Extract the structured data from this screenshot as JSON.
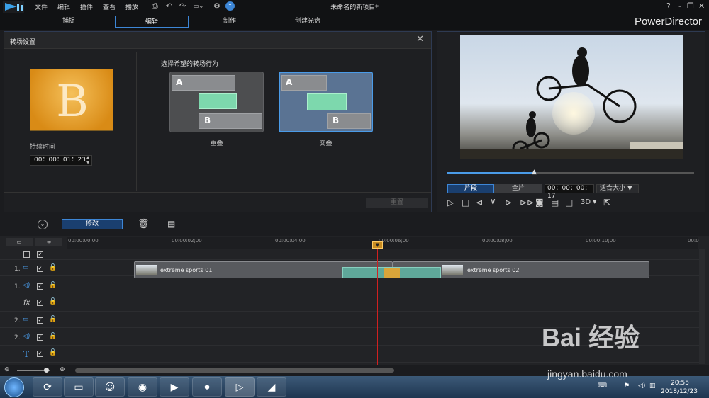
{
  "menu": [
    "文件",
    "编辑",
    "插件",
    "查看",
    "播放"
  ],
  "window_title": "未命名的新项目*",
  "modes": [
    "捕捉",
    "编辑",
    "制作",
    "创建光盘"
  ],
  "brand": "PowerDirector",
  "transition": {
    "panel_title": "转场设置",
    "thumb_letter": "B",
    "duration_label": "持续时间",
    "duration_value": "00：00：01：23",
    "choose_label": "选择希望的转场行为",
    "option1": {
      "label": "重叠",
      "a": "A",
      "b": "B"
    },
    "option2": {
      "label": "交叠",
      "a": "A",
      "b": "B"
    },
    "ok_label": "重置"
  },
  "preview": {
    "segment_label": "片段",
    "full_label": "全片",
    "timecode": "00：00：00：17",
    "fit_label": "适合大小",
    "mode_3d": "3D",
    "progress_fraction": 0.36
  },
  "toolbar": {
    "modify_label": "修改"
  },
  "timeline": {
    "ticks": [
      "00:00:00;00",
      "00:00:02;00",
      "00:00:04;00",
      "00:00:06;00",
      "00:00:08;00",
      "00:00:10;00",
      "00:0"
    ],
    "tracks": [
      {
        "num": "1.",
        "type": "video"
      },
      {
        "num": "1.",
        "type": "audio"
      },
      {
        "num": "",
        "type": "fx"
      },
      {
        "num": "2.",
        "type": "video"
      },
      {
        "num": "2.",
        "type": "audio"
      },
      {
        "num": "",
        "type": "text"
      }
    ],
    "clip1": "extreme sports 01",
    "clip2": "extreme sports 02"
  },
  "taskbar": {
    "time": "20:55",
    "date": "2018/12/23"
  },
  "watermark": {
    "text": "Bai 经验",
    "url": "jingyan.baidu.com"
  }
}
